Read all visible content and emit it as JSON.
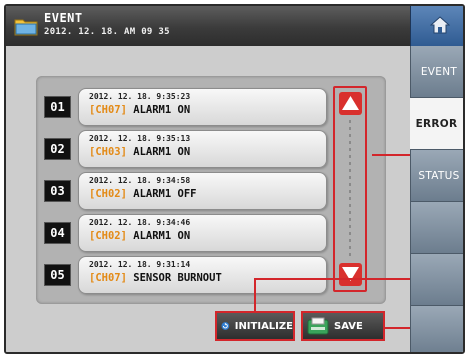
{
  "header": {
    "title": "EVENT",
    "datetime": "2012. 12. 18.  AM 09 35"
  },
  "sidebar": {
    "tabs": [
      {
        "label": "EVENT",
        "active": false
      },
      {
        "label": "ERROR",
        "active": true
      },
      {
        "label": "STATUS",
        "active": false
      },
      {
        "label": "",
        "active": false
      },
      {
        "label": "",
        "active": false
      }
    ]
  },
  "events": [
    {
      "index": "01",
      "timestamp": "2012. 12. 18.   9:35:23",
      "channel": "[CH07]",
      "message": "ALARM1 ON"
    },
    {
      "index": "02",
      "timestamp": "2012. 12. 18.   9:35:13",
      "channel": "[CH03]",
      "message": "ALARM1 ON"
    },
    {
      "index": "03",
      "timestamp": "2012. 12. 18.   9:34:58",
      "channel": "[CH02]",
      "message": "ALARM1 OFF"
    },
    {
      "index": "04",
      "timestamp": "2012. 12. 18.   9:34:46",
      "channel": "[CH02]",
      "message": "ALARM1 ON"
    },
    {
      "index": "05",
      "timestamp": "2012. 12. 18.   9:31:14",
      "channel": "[CH07]",
      "message": "SENSOR BURNOUT"
    }
  ],
  "buttons": {
    "initialize": "INITIALIZE",
    "save": "SAVE"
  },
  "colors": {
    "highlight": "#d3262b",
    "channel": "#e38a16"
  }
}
